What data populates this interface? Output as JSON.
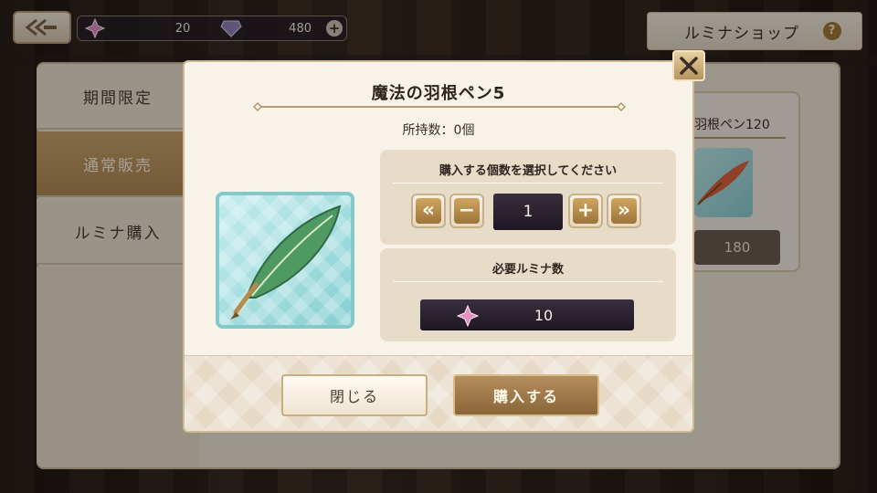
{
  "topbar": {
    "back_icon": "double-arrow-left-icon",
    "currency_1": {
      "icon": "pink-star-crystal-icon",
      "value": "20"
    },
    "currency_2": {
      "icon": "purple-gem-icon",
      "value": "480"
    },
    "add_icon": "plus-icon",
    "add_label": "+"
  },
  "shop": {
    "title": "ルミナショップ",
    "help_label": "?"
  },
  "side_tabs": [
    {
      "label": "期間限定",
      "active": false
    },
    {
      "label": "通常販売",
      "active": true
    },
    {
      "label": "ルミナ購入",
      "active": false
    }
  ],
  "background_card": {
    "title": "羽根ペン120",
    "price": "180"
  },
  "dialog": {
    "title": "魔法の羽根ペン5",
    "owned": "所持数：0個",
    "item_icon": "green-feather-quill-icon",
    "quantity_prompt": "購入する個数を選択してください",
    "quantity": "1",
    "first_label": "«",
    "minus_label": "−",
    "plus_label": "+",
    "last_label": "»",
    "cost_label": "必要ルミナ数",
    "cost_icon": "pink-star-crystal-icon",
    "cost_value": "10",
    "close_button": "閉じる",
    "buy_button": "購入する",
    "close_icon": "x-close-icon"
  },
  "colors": {
    "accent_gold": "#b48d5d",
    "dark_field": "#1e1722",
    "panel_bg": "#f8f2e8",
    "teal_frame": "#83c9c9"
  }
}
